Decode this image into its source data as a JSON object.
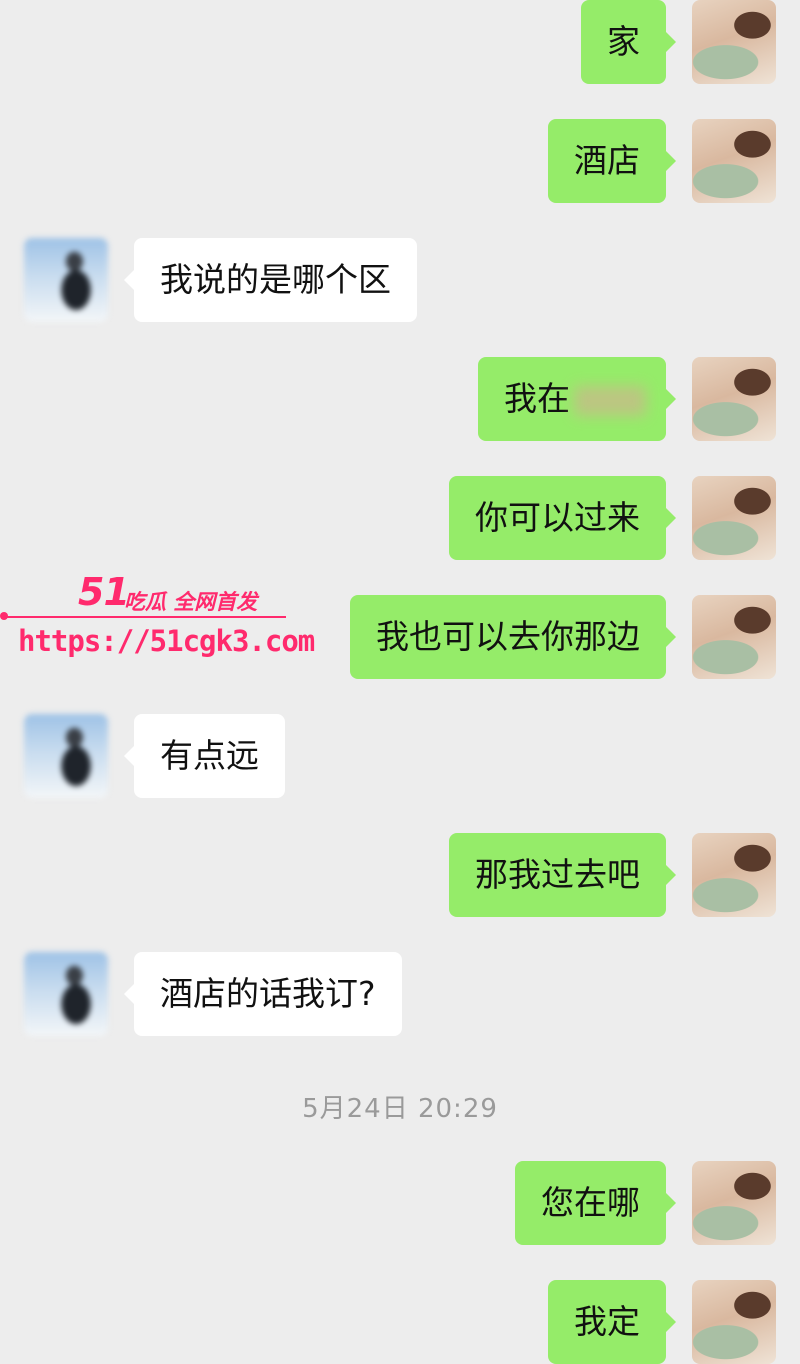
{
  "messages": [
    {
      "side": "me",
      "text": "家"
    },
    {
      "side": "me",
      "text": "酒店"
    },
    {
      "side": "other",
      "text": "我说的是哪个区"
    },
    {
      "side": "me",
      "text": "我在",
      "redacted": true
    },
    {
      "side": "me",
      "text": "你可以过来"
    },
    {
      "side": "me",
      "text": "我也可以去你那边"
    },
    {
      "side": "other",
      "text": "有点远"
    },
    {
      "side": "me",
      "text": "那我过去吧"
    },
    {
      "side": "other",
      "text": "酒店的话我订?"
    },
    {
      "side": "me",
      "text": "您在哪"
    },
    {
      "side": "me",
      "text": "我定"
    }
  ],
  "timestamp": "5月24日 20:29",
  "watermark": {
    "brand": "51",
    "tagline": "吃瓜 全网首发",
    "url": "https://51cgk3.com"
  },
  "colors": {
    "background": "#ededed",
    "my_bubble": "#95ec69",
    "other_bubble": "#ffffff",
    "watermark": "#ff2a6d",
    "timestamp": "#9a9a9a"
  }
}
